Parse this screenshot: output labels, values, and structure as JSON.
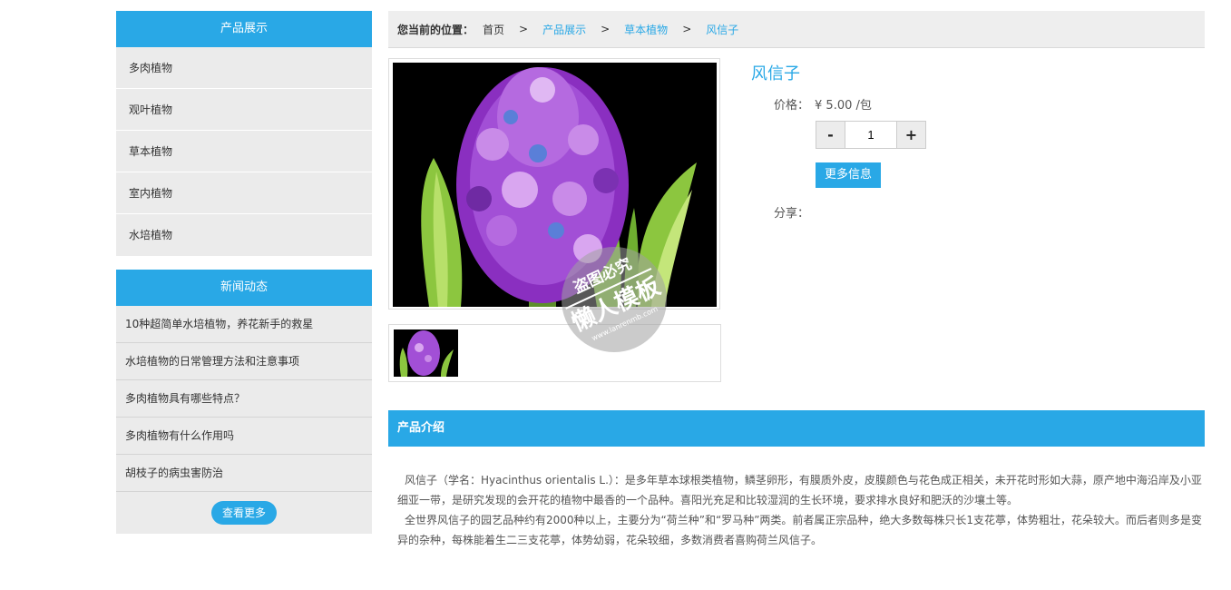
{
  "sidebar": {
    "products_title": "产品展示",
    "categories": [
      "多肉植物",
      "观叶植物",
      "草本植物",
      "室内植物",
      "水培植物"
    ],
    "news_title": "新闻动态",
    "news": [
      "10种超简单水培植物，养花新手的救星",
      "水培植物的日常管理方法和注意事项",
      "多肉植物具有哪些特点？",
      "多肉植物有什么作用吗",
      "胡枝子的病虫害防治"
    ],
    "news_more": "查看更多"
  },
  "breadcrumb": {
    "label": "您当前的位置：",
    "items": [
      "首页",
      "产品展示",
      "草本植物",
      "风信子"
    ],
    "separator": ">"
  },
  "product": {
    "title": "风信子",
    "price_label": "价格：",
    "price_value": "¥ 5.00 /包",
    "qty_minus": "-",
    "qty_value": "1",
    "qty_plus": "+",
    "more_info": "更多信息",
    "share_label": "分享："
  },
  "watermark": {
    "line1": "盗图必究",
    "line2": "懒人模板",
    "url": "www.lanrenmb.com"
  },
  "intro": {
    "title": "产品介绍",
    "paragraphs": [
      "风信子（学名：Hyacinthus orientalis L.）：是多年草本球根类植物，鳞茎卵形，有膜质外皮，皮膜颜色与花色成正相关，未开花时形如大蒜，原产地中海沿岸及小亚细亚一带，是研究发现的会开花的植物中最香的一个品种。喜阳光充足和比较湿润的生长环境，要求排水良好和肥沃的沙壤土等。",
      "全世界风信子的园艺品种约有2000种以上，主要分为“荷兰种”和“罗马种”两类。前者属正宗品种，绝大多数每株只长1支花葶，体势粗壮，花朵较大。而后者则多是变异的杂种，每株能着生二三支花葶，体势幼弱，花朵较细，多数消费者喜购荷兰风信子。"
    ]
  },
  "colors": {
    "accent": "#29a8e6",
    "panel_bg": "#ebebeb",
    "flower_purple": "#9b3fd0",
    "leaf_green": "#8cc63f"
  }
}
